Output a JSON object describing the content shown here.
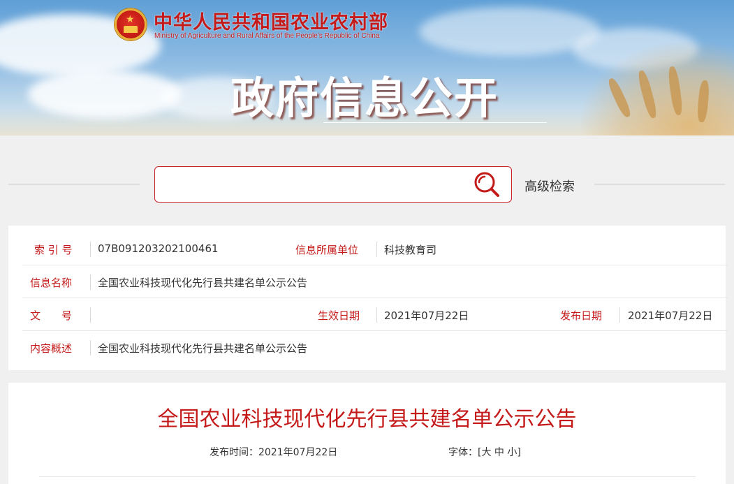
{
  "header": {
    "ministry_cn": "中华人民共和国农业农村部",
    "ministry_en": "Ministry of Agriculture and Rural Affairs of the People's Republic of China",
    "section_title": "政府信息公开"
  },
  "search": {
    "placeholder": "",
    "value": "",
    "advanced_label": "高级检索",
    "icon": "search-icon"
  },
  "info": {
    "index_label": "索 引 号",
    "index_value": "07B091203202100461",
    "unit_label": "信息所属单位",
    "unit_value": "科技教育司",
    "name_label": "信息名称",
    "name_value": "全国农业科技现代化先行县共建名单公示公告",
    "doc_label": "文　　号",
    "doc_value": "",
    "effective_label": "生效日期",
    "effective_value": "2021年07月22日",
    "publish_label": "发布日期",
    "publish_value": "2021年07月22日",
    "summary_label": "内容概述",
    "summary_value": "全国农业科技现代化先行县共建名单公示公告"
  },
  "article": {
    "title": "全国农业科技现代化先行县共建名单公示公告",
    "publish_time_label": "发布时间：",
    "publish_time_value": "2021年07月22日",
    "font_label": "字体：",
    "font_open": "[",
    "font_large": "大",
    "font_medium": "中",
    "font_small": "小",
    "font_close": "]"
  },
  "colors": {
    "accent": "#c41a1a",
    "background": "#f0f0f0",
    "panel": "#ffffff"
  }
}
